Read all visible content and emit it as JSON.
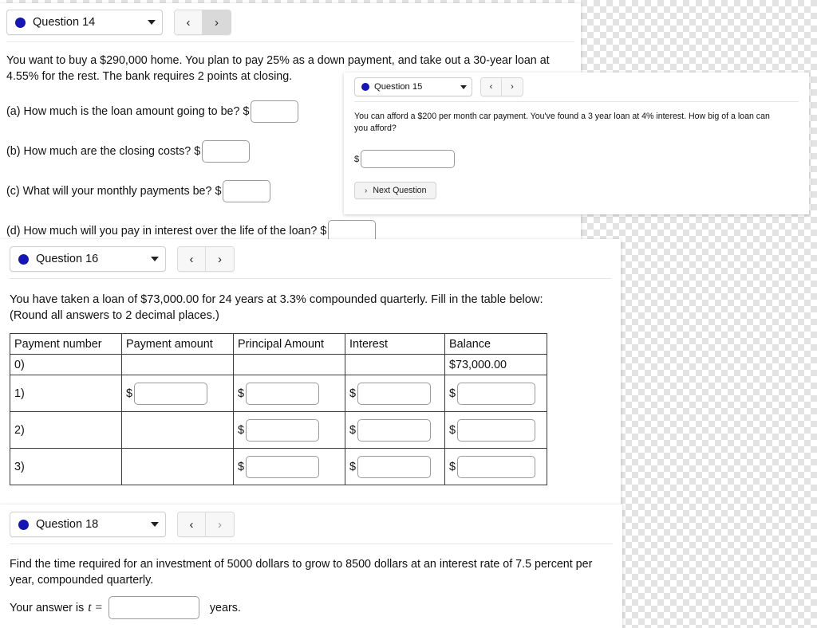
{
  "panels": {
    "q14": {
      "selector_label": "Question 14",
      "nav": {
        "prev": "‹",
        "next": "›"
      },
      "prompt": "You want to buy a $290,000 home. You plan to pay 25% as a down payment, and take out a 30-year loan at 4.55% for the rest. The bank requires 2 points at closing.",
      "parts": [
        {
          "label": "(a) How much is the loan amount going to be?",
          "currency": "$",
          "value": ""
        },
        {
          "label": "(b) How much are the closing costs?",
          "currency": "$",
          "value": ""
        },
        {
          "label": "(c) What will your monthly payments be?",
          "currency": "$",
          "value": ""
        },
        {
          "label": "(d) How much will you pay in interest over the life of the loan?",
          "currency": "$",
          "value": ""
        }
      ]
    },
    "q15": {
      "selector_label": "Question 15",
      "nav": {
        "prev": "‹",
        "next": "›"
      },
      "prompt": "You can afford a $200 per month car payment. You've found a 3 year loan at 4% interest. How big of a loan can you afford?",
      "currency": "$",
      "answer_value": "",
      "next_button": {
        "chevron": "›",
        "label": "Next Question"
      }
    },
    "q16": {
      "selector_label": "Question 16",
      "nav": {
        "prev": "‹",
        "next": "›"
      },
      "prompt_line1": "You have taken a loan of $73,000.00 for 24 years at 3.3% compounded quarterly. Fill in the table below:",
      "prompt_line2": "(Round all answers to 2 decimal places.)",
      "table": {
        "headers": [
          "Payment number",
          "Payment amount",
          "Principal Amount",
          "Interest",
          "Balance"
        ],
        "rows": [
          {
            "number": "0)",
            "payment_amount": {
              "type": "empty"
            },
            "principal": {
              "type": "empty"
            },
            "interest": {
              "type": "empty"
            },
            "balance": {
              "type": "text",
              "value": "$73,000.00"
            }
          },
          {
            "number": "1)",
            "payment_amount": {
              "type": "input",
              "currency": "$",
              "value": ""
            },
            "principal": {
              "type": "input",
              "currency": "$",
              "value": ""
            },
            "interest": {
              "type": "input",
              "currency": "$",
              "value": ""
            },
            "balance": {
              "type": "input",
              "currency": "$",
              "value": ""
            }
          },
          {
            "number": "2)",
            "payment_amount": {
              "type": "empty"
            },
            "principal": {
              "type": "input",
              "currency": "$",
              "value": ""
            },
            "interest": {
              "type": "input",
              "currency": "$",
              "value": ""
            },
            "balance": {
              "type": "input",
              "currency": "$",
              "value": ""
            }
          },
          {
            "number": "3)",
            "payment_amount": {
              "type": "empty"
            },
            "principal": {
              "type": "input",
              "currency": "$",
              "value": ""
            },
            "interest": {
              "type": "input",
              "currency": "$",
              "value": ""
            },
            "balance": {
              "type": "input",
              "currency": "$",
              "value": ""
            }
          }
        ]
      }
    },
    "q18": {
      "selector_label": "Question 18",
      "nav": {
        "prev": "‹",
        "next": "›"
      },
      "prompt": "Find the time required for an investment of 5000 dollars to grow to 8500 dollars at an interest rate of 7.5 percent per year, compounded quarterly.",
      "answer_prefix": "Your answer is",
      "answer_variable": "t =",
      "answer_value": "",
      "answer_suffix": "years."
    }
  },
  "colors": {
    "status_dot": "#1616b4",
    "panel_background": "#ffffff",
    "input_border": "#9a9a9a",
    "table_border": "#3a3a3a",
    "nav_active": "#d9d9d9"
  }
}
